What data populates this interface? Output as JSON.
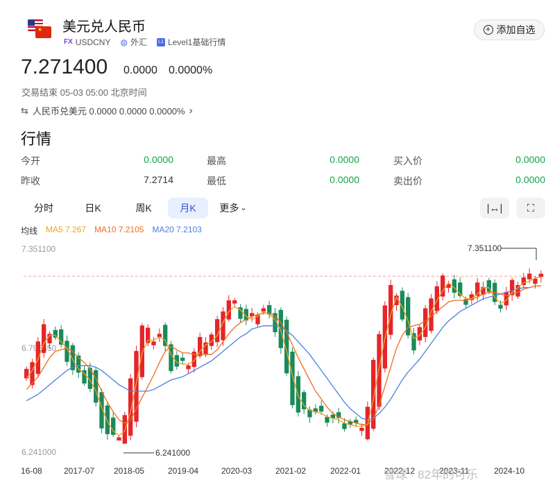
{
  "header": {
    "title": "美元兑人民币",
    "badge": "FX",
    "symbol": "USDCNY",
    "market": "外汇",
    "level": "Level1基础行情",
    "add_button": "添加自选"
  },
  "quote": {
    "price": "7.271400",
    "change": "0.0000",
    "change_pct": "0.0000%",
    "status": "交易结束 05-03 05:00 北京时间",
    "related": "人民币兑美元 0.0000 0.0000 0.0000%"
  },
  "market_section": {
    "title": "行情",
    "stats": [
      {
        "label": "今开",
        "value": "0.0000"
      },
      {
        "label": "最高",
        "value": "0.0000"
      },
      {
        "label": "买入价",
        "value": "0.0000"
      },
      {
        "label": "昨收",
        "value": "7.2714"
      },
      {
        "label": "最低",
        "value": "0.0000"
      },
      {
        "label": "卖出价",
        "value": "0.0000"
      }
    ]
  },
  "tabs": [
    "分时",
    "日K",
    "周K",
    "月K",
    "更多"
  ],
  "active_tab": "月K",
  "ma_legend": {
    "label": "均线",
    "ma5": "MA5 7.267",
    "ma10": "MA10 7.2105",
    "ma20": "MA20 7.2103"
  },
  "colors": {
    "up": "#e5252a",
    "down": "#1b8a5a",
    "ma5": "#f0a020",
    "ma10": "#f26b1d",
    "ma20": "#4a7fe0",
    "active_tab_bg": "#e8efff",
    "positive": "#16a34a"
  },
  "chart_data": {
    "type": "candlestick",
    "y_ticks": [
      "7.351100",
      "6.795550",
      "6.241000"
    ],
    "x_ticks": [
      "16-08",
      "2017-07",
      "2018-05",
      "2019-04",
      "2020-03",
      "2021-02",
      "2022-01",
      "2022-12",
      "2023-11",
      "2024-10"
    ],
    "max_label": "7.351100",
    "min_label": "6.241000",
    "ylim": [
      6.241,
      7.3511
    ],
    "ma5": [
      6.63,
      6.68,
      6.75,
      6.85,
      6.9,
      6.9,
      6.86,
      6.82,
      6.75,
      6.69,
      6.66,
      6.62,
      6.55,
      6.45,
      6.36,
      6.3,
      6.27,
      6.3,
      6.42,
      6.6,
      6.79,
      6.87,
      6.87,
      6.89,
      6.87,
      6.78,
      6.73,
      6.72,
      6.72,
      6.74,
      6.8,
      6.84,
      6.86,
      6.9,
      6.98,
      7.05,
      7.08,
      7.06,
      7.02,
      7.0,
      7.02,
      7.05,
      7.03,
      7.0,
      6.93,
      6.8,
      6.65,
      6.52,
      6.46,
      6.43,
      6.42,
      6.41,
      6.39,
      6.38,
      6.37,
      6.35,
      6.34,
      6.33,
      6.33,
      6.34,
      6.5,
      6.7,
      6.88,
      7.03,
      7.14,
      7.08,
      6.99,
      6.88,
      6.9,
      6.95,
      7.05,
      7.12,
      7.18,
      7.23,
      7.2,
      7.16,
      7.13,
      7.13,
      7.16,
      7.2,
      7.2,
      7.14,
      7.1,
      7.12,
      7.17,
      7.2,
      7.23,
      7.24,
      7.26,
      7.267
    ],
    "ma10": [
      6.56,
      6.6,
      6.64,
      6.7,
      6.76,
      6.8,
      6.81,
      6.82,
      6.8,
      6.76,
      6.73,
      6.69,
      6.63,
      6.55,
      6.48,
      6.42,
      6.37,
      6.35,
      6.37,
      6.44,
      6.51,
      6.58,
      6.65,
      6.73,
      6.8,
      6.83,
      6.81,
      6.79,
      6.79,
      6.78,
      6.78,
      6.78,
      6.78,
      6.81,
      6.86,
      6.91,
      6.95,
      6.98,
      7.0,
      7.02,
      7.03,
      7.04,
      7.04,
      7.02,
      6.98,
      6.92,
      6.84,
      6.76,
      6.69,
      6.62,
      6.55,
      6.5,
      6.45,
      6.41,
      6.39,
      6.37,
      6.36,
      6.35,
      6.34,
      6.34,
      6.38,
      6.46,
      6.58,
      6.7,
      6.82,
      6.9,
      6.95,
      6.96,
      6.97,
      6.99,
      7.02,
      7.05,
      7.08,
      7.11,
      7.12,
      7.12,
      7.12,
      7.13,
      7.14,
      7.16,
      7.17,
      7.17,
      7.16,
      7.15,
      7.16,
      7.17,
      7.19,
      7.2,
      7.21,
      7.2105
    ],
    "ma20": [
      6.49,
      6.51,
      6.53,
      6.56,
      6.59,
      6.62,
      6.65,
      6.68,
      6.7,
      6.71,
      6.71,
      6.71,
      6.7,
      6.68,
      6.65,
      6.62,
      6.59,
      6.57,
      6.55,
      6.55,
      6.55,
      6.55,
      6.56,
      6.58,
      6.6,
      6.62,
      6.63,
      6.64,
      6.66,
      6.68,
      6.7,
      6.72,
      6.74,
      6.77,
      6.8,
      6.83,
      6.86,
      6.89,
      6.91,
      6.94,
      6.95,
      6.96,
      6.96,
      6.96,
      6.95,
      6.93,
      6.9,
      6.86,
      6.82,
      6.78,
      6.73,
      6.68,
      6.63,
      6.58,
      6.53,
      6.48,
      6.44,
      6.41,
      6.38,
      6.37,
      6.38,
      6.41,
      6.45,
      6.5,
      6.56,
      6.62,
      6.67,
      6.71,
      6.75,
      6.8,
      6.85,
      6.9,
      6.95,
      6.99,
      7.02,
      7.05,
      7.07,
      7.09,
      7.11,
      7.13,
      7.14,
      7.15,
      7.16,
      7.17,
      7.18,
      7.19,
      7.2,
      7.2,
      7.21,
      7.2103
    ]
  },
  "watermark": "雪球 · 82年的可乐"
}
